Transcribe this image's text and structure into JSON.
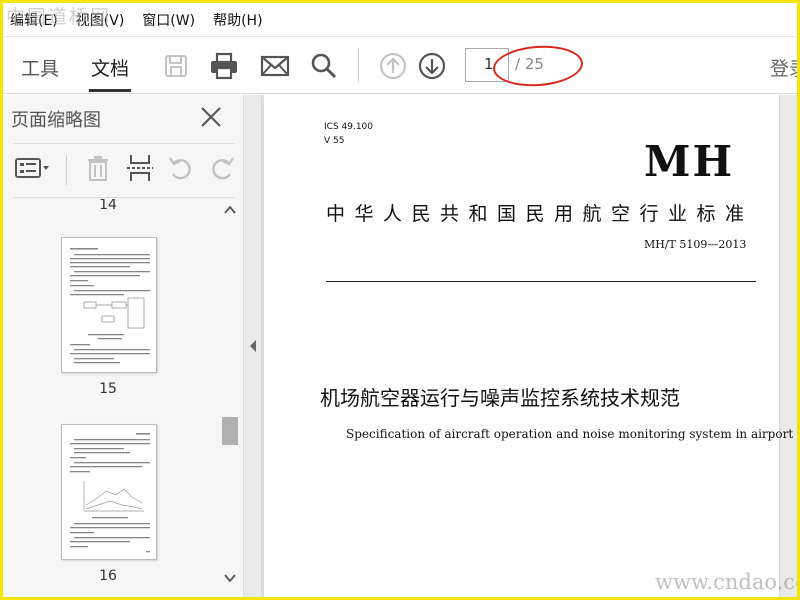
{
  "watermark": {
    "top": "中国道桥网",
    "bottom": "www.cndao.com"
  },
  "menu": [
    "编辑(E)",
    "视图(V)",
    "窗口(W)",
    "帮助(H)"
  ],
  "toolbar": {
    "tabs": [
      {
        "label": "工具"
      },
      {
        "label": "文档",
        "active": true
      }
    ],
    "page_current": "1",
    "page_total": "/ 25",
    "login_label": "登录"
  },
  "sidebar": {
    "title": "页面缩略图",
    "thumbnails": [
      {
        "page": "14"
      },
      {
        "page": "15"
      },
      {
        "page": "16"
      }
    ]
  },
  "document": {
    "ics": "ICS 49.100",
    "class": "V 55",
    "mark": "MH",
    "standard_name": "中华人民共和国民用航空行业标准",
    "code": "MH/T 5109—2013",
    "title_cn": "机场航空器运行与噪声监控系统技术规范",
    "title_en": "Specification of aircraft operation and noise monitoring system in airport"
  },
  "colors": {
    "frame": "#f2e600",
    "annotation": "#d9261c",
    "accent": "#333333"
  }
}
